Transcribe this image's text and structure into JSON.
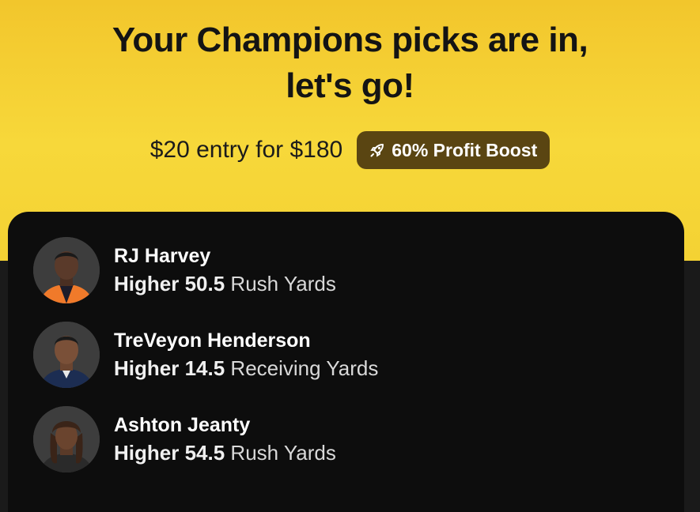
{
  "header": {
    "title_line1": "Your Champions picks are in,",
    "title_line2": "let's go!",
    "entry_text": "$20 entry for $180",
    "boost_label": "60% Profit Boost",
    "boost_icon": "rocket-icon"
  },
  "colors": {
    "hero_bg": "#f4d233",
    "boost_bg": "#5a4512",
    "card_bg": "#0d0d0d"
  },
  "picks": [
    {
      "name": "RJ Harvey",
      "direction": "Higher",
      "line": "50.5",
      "stat": "Rush Yards",
      "jersey": "#f07a2a"
    },
    {
      "name": "TreVeyon Henderson",
      "direction": "Higher",
      "line": "14.5",
      "stat": "Receiving Yards",
      "jersey": "#1c2d52"
    },
    {
      "name": "Ashton Jeanty",
      "direction": "Higher",
      "line": "54.5",
      "stat": "Rush Yards",
      "jersey": "#2a2a2a"
    }
  ]
}
